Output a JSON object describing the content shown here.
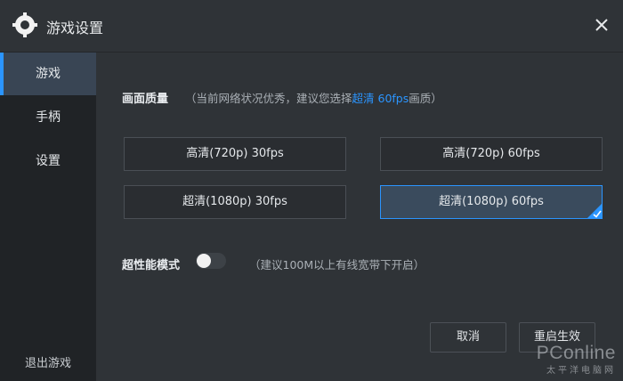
{
  "window": {
    "title": "游戏设置"
  },
  "sidebar": {
    "items": [
      {
        "label": "游戏",
        "active": true
      },
      {
        "label": "手柄",
        "active": false
      },
      {
        "label": "设置",
        "active": false
      }
    ],
    "exit_label": "退出游戏"
  },
  "quality": {
    "title": "画面质量",
    "hint_prefix": "（当前网络状况优秀，建议您选择",
    "hint_highlight": "超清 60fps",
    "hint_suffix": "画质）",
    "options": [
      {
        "label": "高清(720p) 30fps",
        "selected": false
      },
      {
        "label": "高清(720p) 60fps",
        "selected": false
      },
      {
        "label": "超清(1080p) 30fps",
        "selected": false
      },
      {
        "label": "超清(1080p) 60fps",
        "selected": true
      }
    ]
  },
  "performance": {
    "label": "超性能模式",
    "enabled": false,
    "hint": "（建议100M以上有线宽带下开启）"
  },
  "buttons": {
    "cancel": "取消",
    "restart": "重启生效"
  },
  "watermark": {
    "main": "PConline",
    "sub": "太平洋电脑网"
  },
  "colors": {
    "accent": "#2b95ff",
    "sidebar_bg": "#202326",
    "content_bg": "#2f3337"
  }
}
